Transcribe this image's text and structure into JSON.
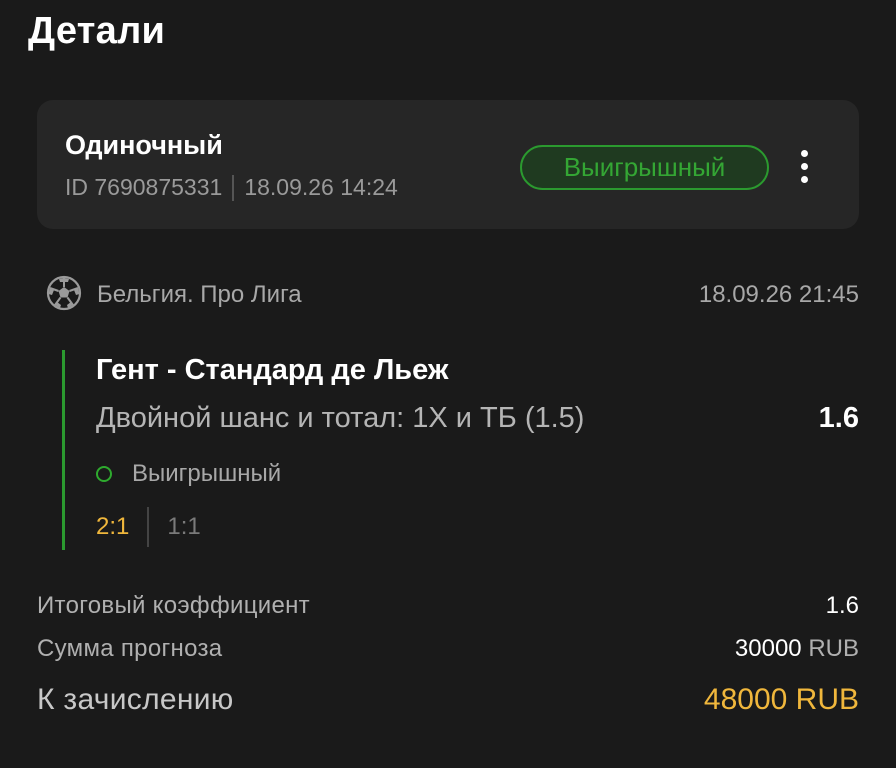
{
  "header": {
    "title": "Детали"
  },
  "bet": {
    "type": "Одиночный",
    "id_text": "ID 7690875331",
    "datetime": "18.09.26 14:24",
    "status": "Выигрышный",
    "status_color": "#34a634"
  },
  "event": {
    "sport_icon": "soccer-ball-icon",
    "league": "Бельгия. Про Лига",
    "start": "18.09.26 21:45",
    "match": "Гент - Стандард де Льеж",
    "market": "Двойной шанс и тотал: 1Х и ТБ (1.5)",
    "odds": "1.6",
    "outcome": "Выигрышный",
    "score": "2:1",
    "half_score": "1:1"
  },
  "summary": {
    "total_coef_label": "Итоговый коэффициент",
    "total_coef_value": "1.6",
    "stake_label": "Сумма прогноза",
    "stake_amount": "30000",
    "stake_currency": "RUB",
    "payout_label": "К зачислению",
    "payout_value": "48000 RUB"
  },
  "colors": {
    "background": "#1a1a1a",
    "card": "#262626",
    "win_green": "#2b9a2f",
    "accent_gold": "#f0b73c"
  }
}
